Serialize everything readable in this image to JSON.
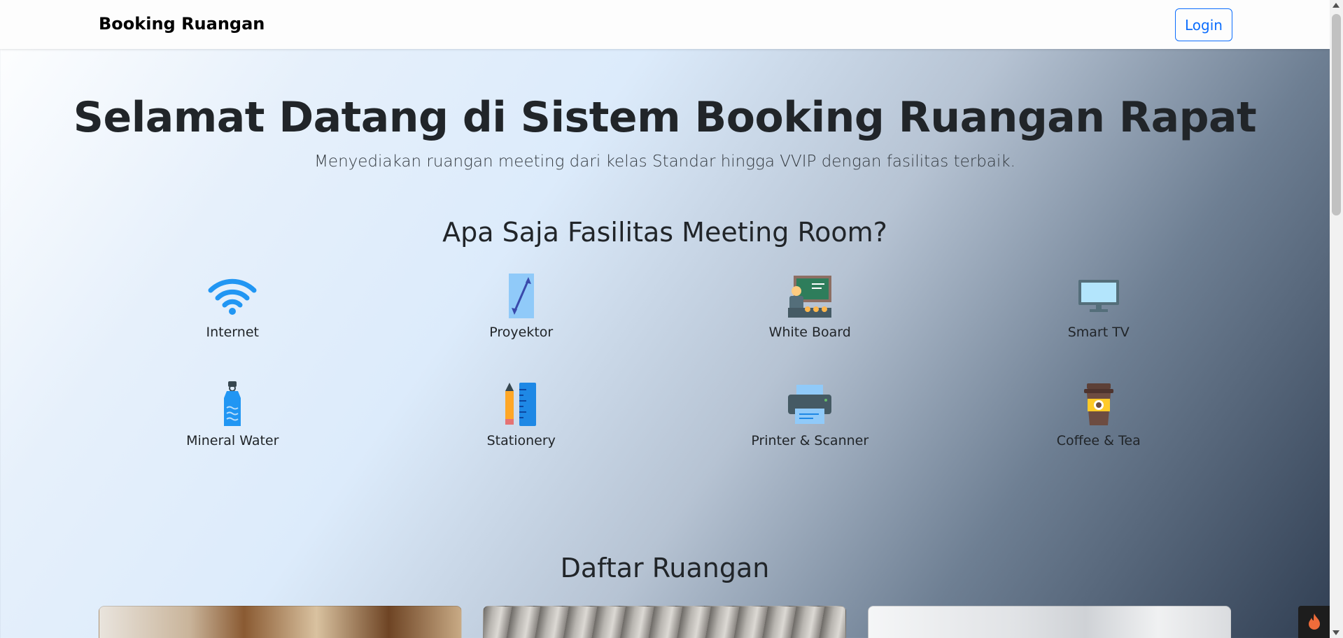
{
  "navbar": {
    "brand": "Booking Ruangan",
    "login_label": "Login"
  },
  "hero": {
    "title": "Selamat Datang di Sistem Booking Ruangan Rapat",
    "subtitle": "Menyediakan ruangan meeting dari kelas Standar hingga VVIP dengan fasilitas terbaik."
  },
  "facilities": {
    "title": "Apa Saja Fasilitas Meeting Room?",
    "items": [
      {
        "label": "Internet",
        "icon": "wifi-icon"
      },
      {
        "label": "Proyektor",
        "icon": "projector-screen-icon"
      },
      {
        "label": "White Board",
        "icon": "teacher-board-icon"
      },
      {
        "label": "Smart TV",
        "icon": "tv-monitor-icon"
      },
      {
        "label": "Mineral Water",
        "icon": "water-bottle-icon"
      },
      {
        "label": "Stationery",
        "icon": "pencil-ruler-icon"
      },
      {
        "label": "Printer & Scanner",
        "icon": "printer-icon"
      },
      {
        "label": "Coffee & Tea",
        "icon": "coffee-cup-icon"
      }
    ]
  },
  "rooms": {
    "title": "Daftar Ruangan"
  },
  "colors": {
    "accent": "#0d6efd",
    "wifi": "#2196f3"
  }
}
